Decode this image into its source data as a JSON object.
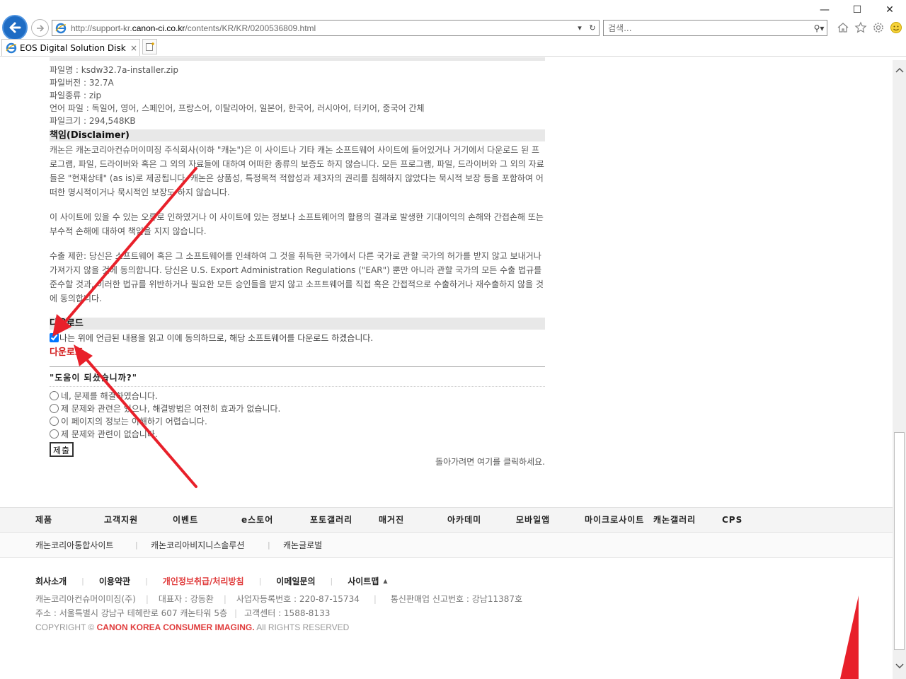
{
  "browser": {
    "url_prefix": "http://support-kr.",
    "url_domain": "canon-ci.co.kr",
    "url_suffix": "/contents/KR/KR/0200536809.html",
    "search_placeholder": "검색...",
    "tab_title": "EOS Digital Solution Disk ...",
    "tab_close": "×",
    "minimize": "—",
    "maximize": "☐",
    "close": "✕"
  },
  "file_info": {
    "filename": "파일명 : ksdw32.7a-installer.zip",
    "version": "파일버전 : 32.7A",
    "type": "파일종류 : zip",
    "languages": "언어 파일 : 독일어, 영어, 스페인어, 프랑스어, 이탈리아어, 일본어, 한국어, 러시아어, 터키어, 중국어 간체",
    "size": "파일크기 : 294,548KB"
  },
  "disclaimer": {
    "heading": "책임(Disclaimer)",
    "para1": "캐논은 캐논코리아컨슈머이미징 주식회사(이하 \"캐논\")은 이 사이트나 기타 캐논 소프트웨어 사이트에 들어있거나 거기에서 다운로드 된 프로그램, 파일, 드라이버와 혹은 그 외의 자료들에 대하여 어떠한 종류의 보증도 하지 않습니다. 모든 프로그램, 파일, 드라이버와 그 외의 자료들은 \"현재상태\" (as is)로 제공됩니다. 캐논은 상품성, 특정목적 적합성과 제3자의 권리를 침해하지 않았다는 묵시적 보장 등을 포함하여 어떠한 명시적이거나 묵시적인 보장도 하지 않습니다.",
    "para2": "이 사이트에 있을 수 있는 오류로 인하였거나 이 사이트에 있는 정보나 소프트웨어의 활용의 결과로 발생한 기대이익의 손해와 간접손해 또는 부수적 손해에 대하여 책임을 지지 않습니다.",
    "para3": "수출 제한: 당신은 소프트웨어 혹은 그 소프트웨어를 인쇄하여 그 것을 취득한 국가에서 다른 국가로 관할 국가의 허가를 받지 않고 보내거나 가져가지 않을 것에 동의합니다. 당신은 U.S. Export Administration Regulations (\"EAR\") 뿐만 아니라 관할 국가의 모든 수출 법규를 준수할 것과, 이러한 법규를 위반하거나 필요한 모든 승인들을 받지 않고 소프트웨어를 직접 혹은 간접적으로 수출하거나 재수출하지 않을 것에 동의합니다."
  },
  "download": {
    "heading": "다운로드",
    "agree_text": "나는 위에 언급된 내용을 읽고 이에 동의하므로, 해당 소프트웨어를 다운로드 하겠습니다.",
    "agree_checked": true,
    "link": "다운로드"
  },
  "survey": {
    "question": "\"도움이 되셨습니까?\"",
    "options": [
      "네, 문제를 해결하였습니다.",
      "제 문제와 관련은 있으나, 해결방법은 여전히 효과가 없습니다.",
      "이 페이지의 정보는 이해하기 어렵습니다.",
      "제 문제와 관련이 없습니다."
    ],
    "submit": "제출",
    "back": "돌아가려면 여기를 클릭하세요."
  },
  "gnb": [
    "제품",
    "고객지원",
    "이벤트",
    "e스토어",
    "포토갤러리",
    "매거진",
    "아카데미",
    "모바일앱",
    "마이크로사이트",
    "캐논갤러리",
    "CPS"
  ],
  "sub_links": [
    "캐논코리아통합사이트",
    "캐논코리아비지니스솔루션",
    "캐논글로벌"
  ],
  "sub_sep": "|",
  "footer": {
    "links": [
      "회사소개",
      "이용약관",
      "개인정보취급/처리방침",
      "이메일문의",
      "사이트맵"
    ],
    "sep": "|",
    "caret": "▲",
    "corp": "캐논코리아컨슈머이미징(주)",
    "ceo": "대표자 : 강동환",
    "bizno": "사업자등록번호 : 220-87-15734",
    "mailorder": "통신판매업 신고번호 : 강남11387호",
    "address": "주소 : 서울특별시 강남구 테헤란로 607 캐논타워 5층",
    "center": "고객센터 : 1588-8133",
    "copyright_pre": "COPYRIGHT © ",
    "copyright_brand": "CANON KOREA CONSUMER IMAGING.",
    "copyright_post": " All RIGHTS RESERVED"
  },
  "colors": {
    "accent_red": "#d21a1a",
    "annotation_red": "#e8202a",
    "ie_blue": "#1e6cc4"
  }
}
